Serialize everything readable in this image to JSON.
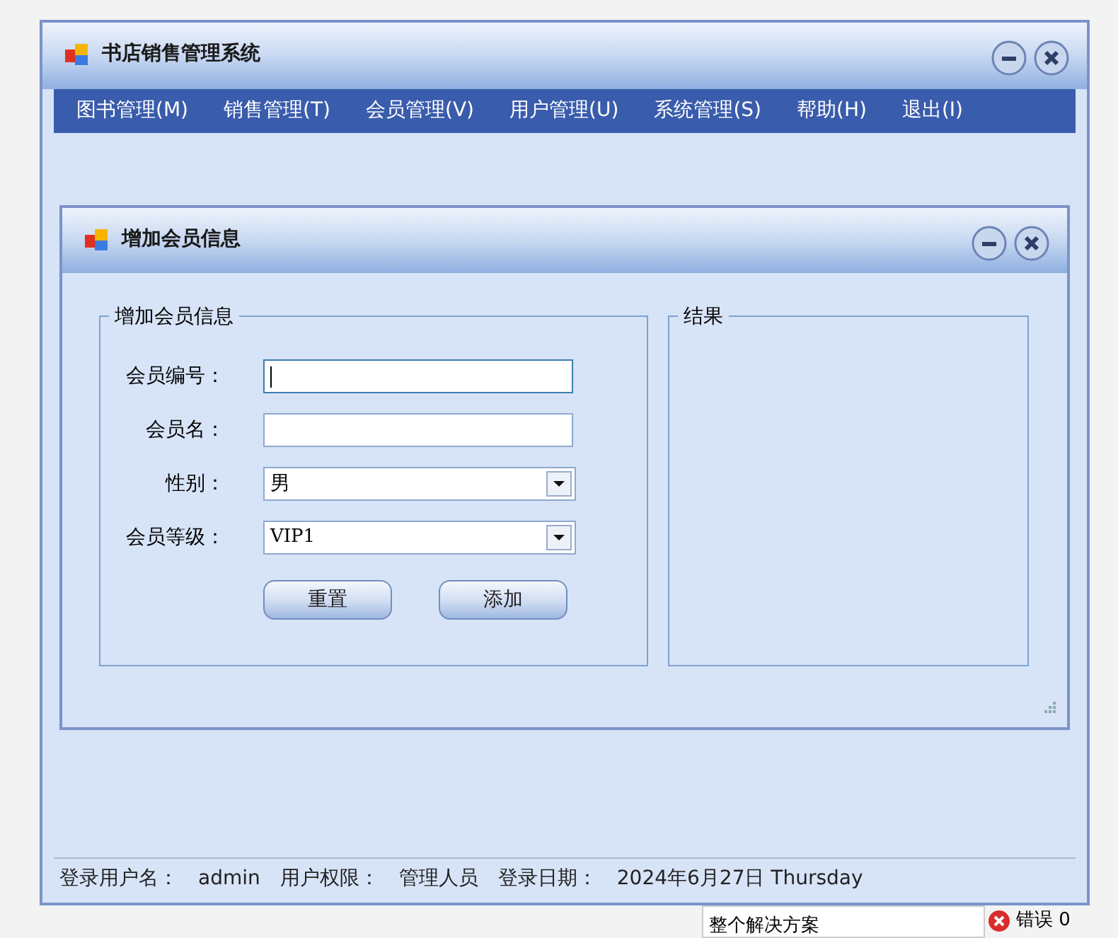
{
  "window": {
    "title": "书店销售管理系统"
  },
  "menu": [
    {
      "label": "图书管理(M)"
    },
    {
      "label": "销售管理(T)"
    },
    {
      "label": "会员管理(V)"
    },
    {
      "label": "用户管理(U)"
    },
    {
      "label": "系统管理(S)"
    },
    {
      "label": "帮助(H)"
    },
    {
      "label": "退出(I)"
    }
  ],
  "child_window": {
    "title": "增加会员信息",
    "form_group": {
      "title": "增加会员信息",
      "fields": [
        {
          "kind": "text",
          "label": "会员编号：",
          "focused": true
        },
        {
          "kind": "text",
          "label": "会员名：",
          "focused": false
        },
        {
          "kind": "dropdown",
          "label": "性别：",
          "value": "男"
        },
        {
          "kind": "dropdown",
          "label": "会员等级：",
          "value": "VIP1"
        }
      ],
      "buttons": [
        "重置",
        "添加"
      ]
    },
    "result_group": {
      "title": "结果"
    }
  },
  "status_bar": [
    {
      "label": "登录用户名：",
      "value": "admin"
    },
    {
      "label": "用户权限：",
      "value": "管理人员"
    },
    {
      "label": "登录日期：",
      "value": "2024年6月27日 Thursday"
    }
  ],
  "background_ide": {
    "scope_dropdown": "整个解决方案",
    "errors": "错误 0"
  }
}
